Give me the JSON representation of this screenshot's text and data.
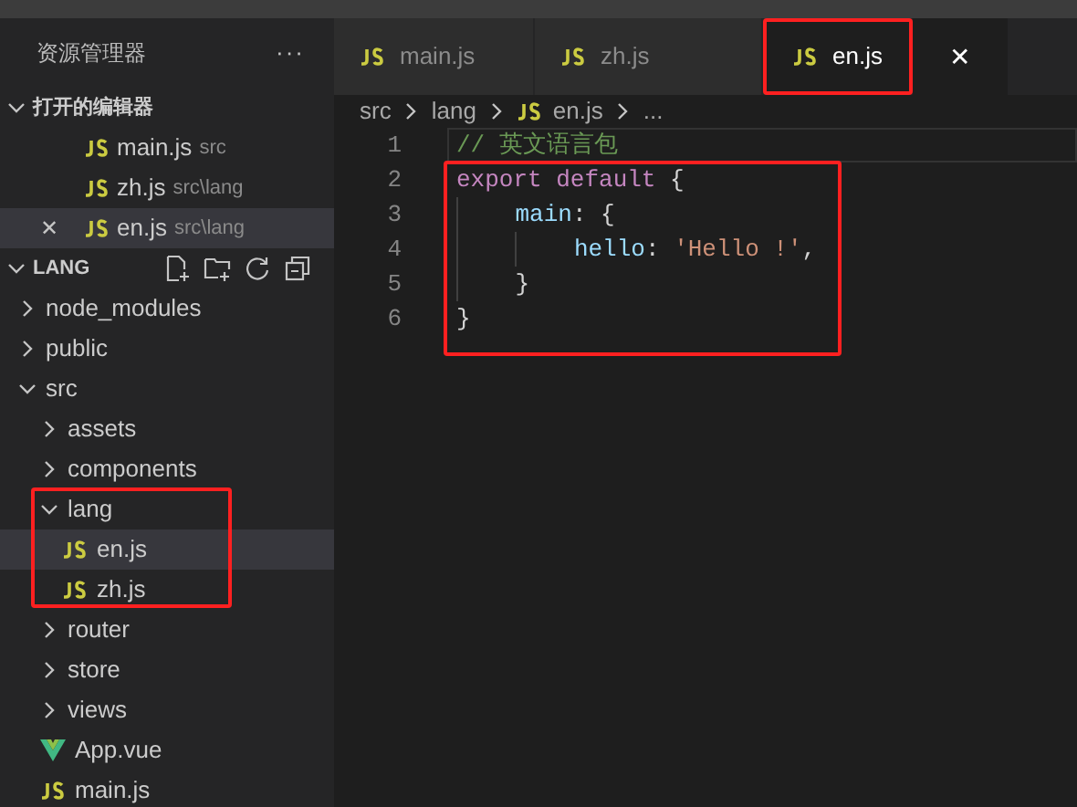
{
  "sidebar": {
    "title": "资源管理器",
    "more": "···",
    "open_editors": {
      "title": "打开的编辑器",
      "expanded": true,
      "items": [
        {
          "name": "main.js",
          "path": "src",
          "selected": false
        },
        {
          "name": "zh.js",
          "path": "src\\lang",
          "selected": false
        },
        {
          "name": "en.js",
          "path": "src\\lang",
          "selected": true
        }
      ]
    },
    "folder": {
      "title": "LANG",
      "expanded": true,
      "tree": [
        {
          "name": "node_modules",
          "kind": "folder",
          "expanded": false,
          "selected": false,
          "highlighted": false
        },
        {
          "name": "public",
          "kind": "folder",
          "expanded": false,
          "selected": false,
          "highlighted": false
        },
        {
          "name": "src",
          "kind": "folder",
          "expanded": true,
          "selected": false,
          "highlighted": false,
          "children": [
            {
              "name": "assets",
              "kind": "folder",
              "expanded": false,
              "selected": false,
              "highlighted": false
            },
            {
              "name": "components",
              "kind": "folder",
              "expanded": false,
              "selected": false,
              "highlighted": false
            },
            {
              "name": "lang",
              "kind": "folder",
              "expanded": true,
              "selected": false,
              "highlighted": true,
              "children": [
                {
                  "name": "en.js",
                  "kind": "js",
                  "selected": true,
                  "highlighted": false
                },
                {
                  "name": "zh.js",
                  "kind": "js",
                  "selected": false,
                  "highlighted": false
                }
              ]
            },
            {
              "name": "router",
              "kind": "folder",
              "expanded": false,
              "selected": false,
              "highlighted": false
            },
            {
              "name": "store",
              "kind": "folder",
              "expanded": false,
              "selected": false,
              "highlighted": false
            },
            {
              "name": "views",
              "kind": "folder",
              "expanded": false,
              "selected": false,
              "highlighted": false
            },
            {
              "name": "App.vue",
              "kind": "vue",
              "selected": false,
              "highlighted": false
            },
            {
              "name": "main.js",
              "kind": "js",
              "selected": false,
              "highlighted": false
            }
          ]
        }
      ]
    }
  },
  "tabs": [
    {
      "label": "main.js",
      "selected": false,
      "highlighted": false
    },
    {
      "label": "zh.js",
      "selected": false,
      "highlighted": false
    },
    {
      "label": "en.js",
      "selected": true,
      "highlighted": true
    }
  ],
  "close": "✕",
  "breadcrumb": [
    "src",
    "lang",
    "en.js",
    "..."
  ],
  "code": {
    "lines": [
      {
        "number": "1",
        "highlighted": false,
        "current": true,
        "tokens": [
          {
            "kind": "comment",
            "text": "// 英文语言包"
          }
        ]
      },
      {
        "number": "2",
        "highlighted": true,
        "current": false,
        "tokens": [
          {
            "kind": "keyword",
            "text": "export default"
          },
          {
            "kind": "punct",
            "text": " {"
          }
        ]
      },
      {
        "number": "3",
        "highlighted": true,
        "current": false,
        "tokens": [
          {
            "kind": "property",
            "text": "    main"
          },
          {
            "kind": "punct",
            "text": ": {"
          }
        ]
      },
      {
        "number": "4",
        "highlighted": true,
        "current": false,
        "tokens": [
          {
            "kind": "property",
            "text": "        hello"
          },
          {
            "kind": "punct",
            "text": ": "
          },
          {
            "kind": "string",
            "text": "'Hello !'"
          },
          {
            "kind": "punct",
            "text": ","
          }
        ]
      },
      {
        "number": "5",
        "highlighted": true,
        "current": false,
        "tokens": [
          {
            "kind": "punct",
            "text": "    }"
          }
        ]
      },
      {
        "number": "6",
        "highlighted": true,
        "current": false,
        "tokens": [
          {
            "kind": "punct",
            "text": "}"
          }
        ]
      }
    ]
  }
}
